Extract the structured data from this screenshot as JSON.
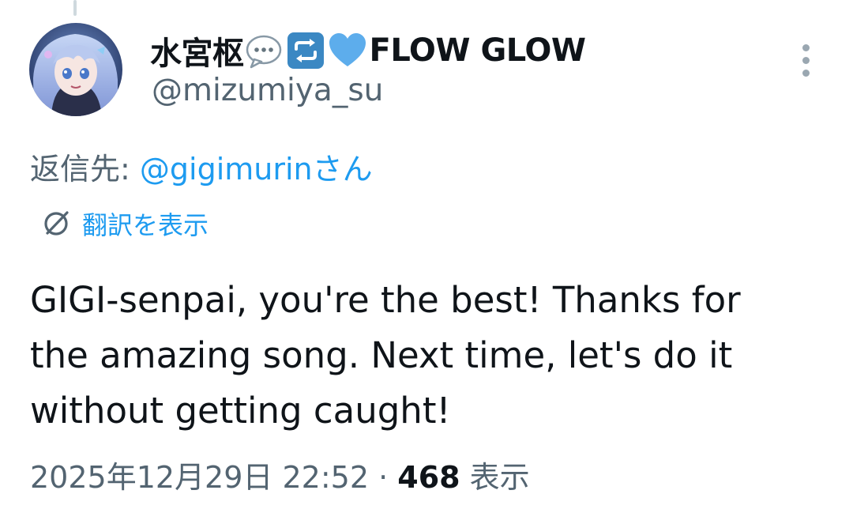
{
  "author": {
    "display_name": "水宮枢",
    "name_emojis": [
      "speech-bubble-emoji",
      "repeat-emoji",
      "blue-heart-emoji"
    ],
    "name_suffix": "FLOW GLOW",
    "handle": "@mizumiya_su",
    "avatar_icon": "anime-avatar"
  },
  "reply": {
    "prefix": "返信先: ",
    "mention": "@gigimurin",
    "suffix": "さん"
  },
  "translate": {
    "icon": "globe-translate-icon",
    "label": "翻訳を表示"
  },
  "tweet": {
    "lines": [
      "GIGI-senpai, you're the best! Thanks for",
      "the amazing song. Next time, let's do it",
      "without getting caught!"
    ]
  },
  "meta": {
    "timestamp": "2025年12月29日 22:52",
    "separator": " · ",
    "views_count": "468",
    "views_label": " 表示"
  },
  "colors": {
    "text": "#0f1419",
    "secondary": "#536471",
    "accent": "#1d9bf0"
  }
}
